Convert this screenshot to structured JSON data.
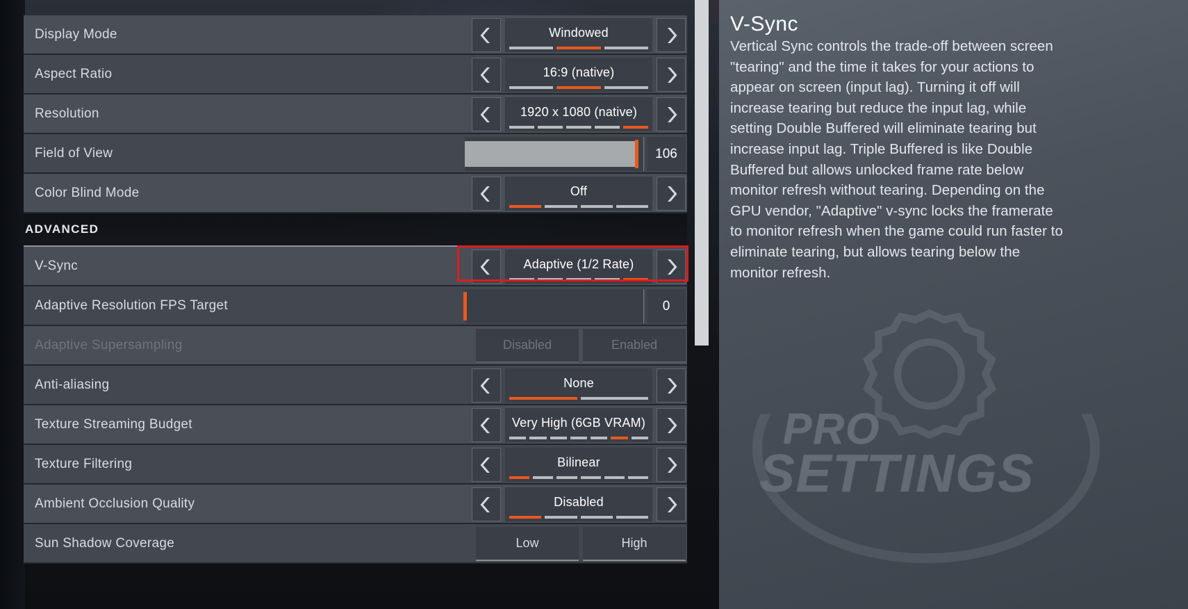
{
  "settings": [
    {
      "id": "display-mode",
      "label": "Display Mode",
      "type": "stepper",
      "value": "Windowed",
      "segments": 3,
      "active_segment": 2
    },
    {
      "id": "aspect-ratio",
      "label": "Aspect Ratio",
      "type": "stepper",
      "value": "16:9 (native)",
      "segments": 3,
      "active_segment": 2
    },
    {
      "id": "resolution",
      "label": "Resolution",
      "type": "stepper",
      "value": "1920 x 1080 (native)",
      "segments": 5,
      "active_segment": 5
    },
    {
      "id": "field-of-view",
      "label": "Field of View",
      "type": "slider",
      "value": "106",
      "fill_percent": 96
    },
    {
      "id": "color-blind-mode",
      "label": "Color Blind Mode",
      "type": "stepper",
      "value": "Off",
      "segments": 4,
      "active_segment": 1
    },
    {
      "id": "advanced-header",
      "label": "ADVANCED",
      "type": "section"
    },
    {
      "id": "v-sync",
      "label": "V-Sync",
      "type": "stepper",
      "value": "Adaptive (1/2 Rate)",
      "segments": 5,
      "active_segment": 5,
      "highlighted": true
    },
    {
      "id": "adaptive-resolution-fps-target",
      "label": "Adaptive Resolution FPS Target",
      "type": "slider",
      "value": "0",
      "fill_percent": 0
    },
    {
      "id": "adaptive-supersampling",
      "label": "Adaptive Supersampling",
      "type": "toggle-pair",
      "disabled": true,
      "option_a": "Disabled",
      "option_b": "Enabled"
    },
    {
      "id": "anti-aliasing",
      "label": "Anti-aliasing",
      "type": "stepper",
      "value": "None",
      "segments": 2,
      "active_segment": 1
    },
    {
      "id": "texture-streaming-budget",
      "label": "Texture Streaming Budget",
      "type": "stepper",
      "value": "Very High (6GB VRAM)",
      "segments": 7,
      "active_segment": 6
    },
    {
      "id": "texture-filtering",
      "label": "Texture Filtering",
      "type": "stepper",
      "value": "Bilinear",
      "segments": 6,
      "active_segment": 1
    },
    {
      "id": "ambient-occlusion-quality",
      "label": "Ambient Occlusion Quality",
      "type": "stepper",
      "value": "Disabled",
      "segments": 4,
      "active_segment": 1
    },
    {
      "id": "sun-shadow-coverage",
      "label": "Sun Shadow Coverage",
      "type": "toggle-pair",
      "disabled": false,
      "option_a": "Low",
      "option_b": "High"
    }
  ],
  "description": {
    "title": "V-Sync",
    "body": "Vertical Sync controls the trade-off between screen \"tearing\" and the time it takes for your actions to appear on screen (input lag). Turning it off will increase tearing but reduce the input lag, while setting Double Buffered will eliminate tearing but increase input lag. Triple Buffered is like Double Buffered but allows unlocked frame rate below monitor refresh without tearing. Depending on the GPU vendor, \"Adaptive\" v-sync locks the framerate to monitor refresh when the game could run faster to eliminate tearing, but allows tearing below the monitor refresh."
  },
  "watermark": {
    "line1": "PRO",
    "line2": "SETTINGS"
  },
  "icons": {
    "left_arrow": "chevron-left-icon",
    "right_arrow": "chevron-right-icon"
  },
  "colors": {
    "accent": "#e8591f",
    "highlight_box": "#e01b1b",
    "row_bg": "#494e57",
    "control_bg": "#3a3e46",
    "text": "#d8dce1"
  }
}
